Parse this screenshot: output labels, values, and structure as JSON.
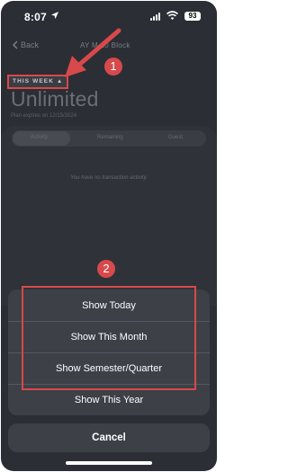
{
  "status": {
    "time": "8:07",
    "battery": "93"
  },
  "header": {
    "back_label": "Back",
    "plan_name": "AY M     10 Block"
  },
  "plan": {
    "period_label": "THIS WEEK",
    "title": "Unlimited",
    "expires": "Plan expires on 12/15/2024"
  },
  "tabs": [
    {
      "label": "Activity",
      "active": true
    },
    {
      "label": "Remaining",
      "active": false
    },
    {
      "label": "Guest",
      "active": false
    }
  ],
  "activity": {
    "empty_message": "You have no transaction activity."
  },
  "action_sheet": {
    "options": [
      "Show Today",
      "Show This Month",
      "Show Semester/Quarter",
      "Show This Year"
    ],
    "cancel_label": "Cancel"
  },
  "annotations": {
    "step1": "1",
    "step2": "2",
    "accent_color": "#d8494b"
  }
}
